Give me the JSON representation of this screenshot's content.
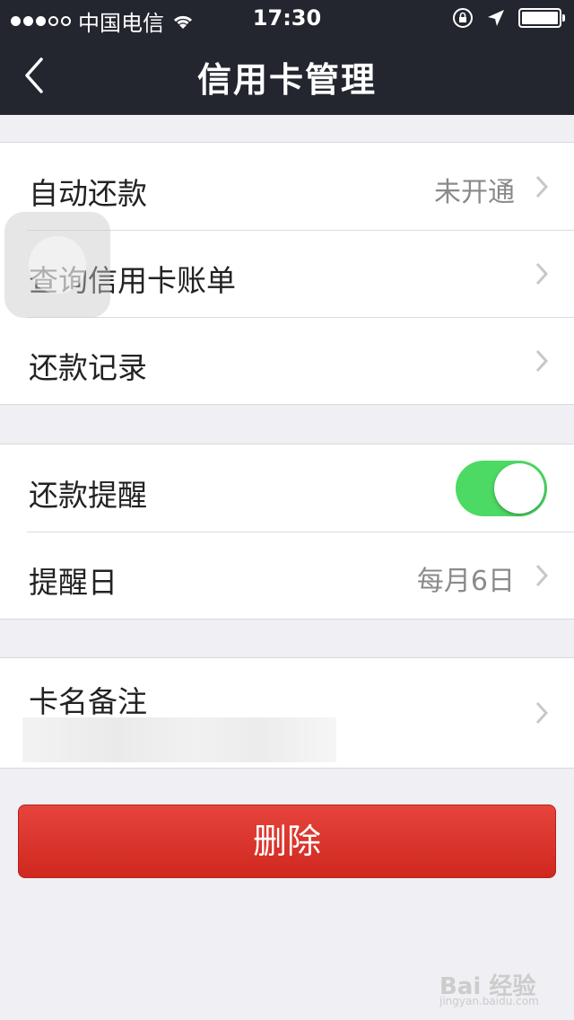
{
  "status_bar": {
    "carrier": "中国电信",
    "time": "17:30",
    "signal_dots_filled": 3,
    "signal_dots_total": 5,
    "battery_level": 1.0
  },
  "nav": {
    "title": "信用卡管理"
  },
  "sections": {
    "auto_pay": {
      "label": "自动还款",
      "value": "未开通"
    },
    "query_bill": {
      "label": "查询信用卡账单"
    },
    "repay_record": {
      "label": "还款记录"
    },
    "reminder": {
      "label": "还款提醒",
      "enabled": true
    },
    "reminder_day": {
      "label": "提醒日",
      "value": "每月6日"
    },
    "card_note": {
      "label": "卡名备注"
    }
  },
  "delete_button": {
    "label": "删除"
  },
  "watermark": {
    "text": "Bai 经验",
    "sub": "jingyan.baidu.com"
  },
  "colors": {
    "nav_bg": "#23262f",
    "toggle_on": "#4cd964",
    "delete_bg": "#d9302a",
    "page_bg": "#efeff4"
  }
}
